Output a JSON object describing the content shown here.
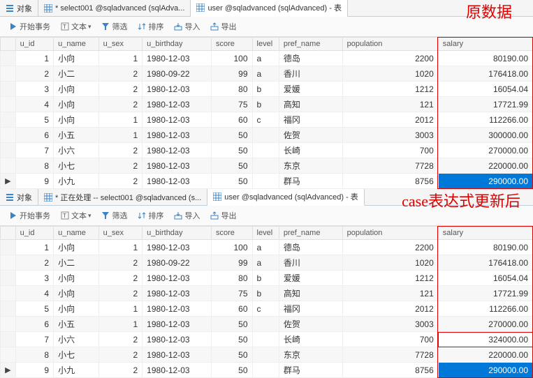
{
  "annot": {
    "top": "原数据",
    "bottom": "case表达式更新后"
  },
  "tabs": {
    "obj": "对象",
    "select1": "* select001 @sqladvanced (sqlAdva...",
    "user1": "user @sqladvanced (sqlAdvanced) - 表",
    "select2": "* 正在处理 -- select001 @sqladvanced (s...",
    "user2": "user @sqladvanced (sqlAdvanced) - 表"
  },
  "toolbar": {
    "start": "开始事务",
    "text": "文本",
    "filter": "筛选",
    "sort": "排序",
    "import": "导入",
    "export": "导出"
  },
  "columns": {
    "u_id": "u_id",
    "u_name": "u_name",
    "u_sex": "u_sex",
    "u_birthday": "u_birthday",
    "score": "score",
    "level": "level",
    "pref_name": "pref_name",
    "population": "population",
    "salary": "salary"
  },
  "chart_data": {
    "type": "table",
    "panes": [
      {
        "label": "原数据",
        "columns": [
          "u_id",
          "u_name",
          "u_sex",
          "u_birthday",
          "score",
          "level",
          "pref_name",
          "population",
          "salary"
        ],
        "rows": [
          {
            "u_id": 1,
            "u_name": "小向",
            "u_sex": 1,
            "u_birthday": "1980-12-03",
            "score": 100,
            "level": "a",
            "pref_name": "德岛",
            "population": 2200,
            "salary": "80190.00"
          },
          {
            "u_id": 2,
            "u_name": "小二",
            "u_sex": 2,
            "u_birthday": "1980-09-22",
            "score": 99,
            "level": "a",
            "pref_name": "香川",
            "population": 1020,
            "salary": "176418.00"
          },
          {
            "u_id": 3,
            "u_name": "小向",
            "u_sex": 2,
            "u_birthday": "1980-12-03",
            "score": 80,
            "level": "b",
            "pref_name": "爱媛",
            "population": 1212,
            "salary": "16054.04"
          },
          {
            "u_id": 4,
            "u_name": "小向",
            "u_sex": 2,
            "u_birthday": "1980-12-03",
            "score": 75,
            "level": "b",
            "pref_name": "高知",
            "population": 121,
            "salary": "17721.99"
          },
          {
            "u_id": 5,
            "u_name": "小向",
            "u_sex": 1,
            "u_birthday": "1980-12-03",
            "score": 60,
            "level": "c",
            "pref_name": "福冈",
            "population": 2012,
            "salary": "112266.00"
          },
          {
            "u_id": 6,
            "u_name": "小五",
            "u_sex": 1,
            "u_birthday": "1980-12-03",
            "score": 50,
            "level": "",
            "pref_name": "佐贺",
            "population": 3003,
            "salary": "300000.00"
          },
          {
            "u_id": 7,
            "u_name": "小六",
            "u_sex": 2,
            "u_birthday": "1980-12-03",
            "score": 50,
            "level": "",
            "pref_name": "长崎",
            "population": 700,
            "salary": "270000.00"
          },
          {
            "u_id": 8,
            "u_name": "小七",
            "u_sex": 2,
            "u_birthday": "1980-12-03",
            "score": 50,
            "level": "",
            "pref_name": "东京",
            "population": 7728,
            "salary": "220000.00"
          },
          {
            "u_id": 9,
            "u_name": "小九",
            "u_sex": 2,
            "u_birthday": "1980-12-03",
            "score": 50,
            "level": "",
            "pref_name": "群马",
            "population": 8756,
            "salary": "290000.00"
          }
        ],
        "selected_row_index": 8
      },
      {
        "label": "case表达式更新后",
        "columns": [
          "u_id",
          "u_name",
          "u_sex",
          "u_birthday",
          "score",
          "level",
          "pref_name",
          "population",
          "salary"
        ],
        "rows": [
          {
            "u_id": 1,
            "u_name": "小向",
            "u_sex": 1,
            "u_birthday": "1980-12-03",
            "score": 100,
            "level": "a",
            "pref_name": "德岛",
            "population": 2200,
            "salary": "80190.00"
          },
          {
            "u_id": 2,
            "u_name": "小二",
            "u_sex": 2,
            "u_birthday": "1980-09-22",
            "score": 99,
            "level": "a",
            "pref_name": "香川",
            "population": 1020,
            "salary": "176418.00"
          },
          {
            "u_id": 3,
            "u_name": "小向",
            "u_sex": 2,
            "u_birthday": "1980-12-03",
            "score": 80,
            "level": "b",
            "pref_name": "爱媛",
            "population": 1212,
            "salary": "16054.04"
          },
          {
            "u_id": 4,
            "u_name": "小向",
            "u_sex": 2,
            "u_birthday": "1980-12-03",
            "score": 75,
            "level": "b",
            "pref_name": "高知",
            "population": 121,
            "salary": "17721.99"
          },
          {
            "u_id": 5,
            "u_name": "小向",
            "u_sex": 1,
            "u_birthday": "1980-12-03",
            "score": 60,
            "level": "c",
            "pref_name": "福冈",
            "population": 2012,
            "salary": "112266.00"
          },
          {
            "u_id": 6,
            "u_name": "小五",
            "u_sex": 1,
            "u_birthday": "1980-12-03",
            "score": 50,
            "level": "",
            "pref_name": "佐贺",
            "population": 3003,
            "salary": "270000.00"
          },
          {
            "u_id": 7,
            "u_name": "小六",
            "u_sex": 2,
            "u_birthday": "1980-12-03",
            "score": 50,
            "level": "",
            "pref_name": "长崎",
            "population": 700,
            "salary": "324000.00",
            "sal_outlined": true
          },
          {
            "u_id": 8,
            "u_name": "小七",
            "u_sex": 2,
            "u_birthday": "1980-12-03",
            "score": 50,
            "level": "",
            "pref_name": "东京",
            "population": 7728,
            "salary": "220000.00"
          },
          {
            "u_id": 9,
            "u_name": "小九",
            "u_sex": 2,
            "u_birthday": "1980-12-03",
            "score": 50,
            "level": "",
            "pref_name": "群马",
            "population": 8756,
            "salary": "290000.00"
          }
        ],
        "selected_row_index": 8
      }
    ]
  }
}
